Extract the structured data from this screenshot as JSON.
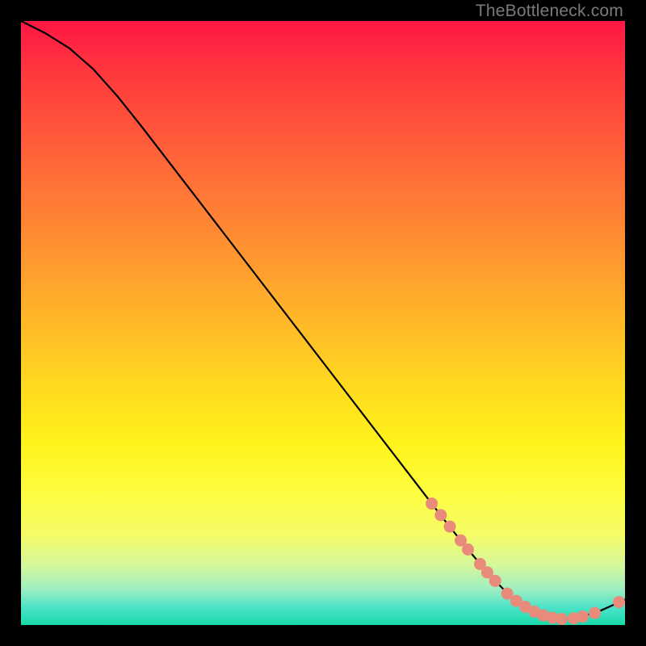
{
  "watermark": {
    "text": "TheBottleneck.com"
  },
  "colors": {
    "curve_stroke": "#000000",
    "marker_fill": "#e98b7a",
    "marker_stroke": "#d57463"
  },
  "chart_data": {
    "type": "line",
    "title": "",
    "xlabel": "",
    "ylabel": "",
    "xlim": [
      0,
      100
    ],
    "ylim": [
      0,
      100
    ],
    "grid": false,
    "curve": [
      {
        "x": 0,
        "y": 100
      },
      {
        "x": 4,
        "y": 98
      },
      {
        "x": 8,
        "y": 95.5
      },
      {
        "x": 12,
        "y": 92
      },
      {
        "x": 16,
        "y": 87.5
      },
      {
        "x": 20,
        "y": 82.5
      },
      {
        "x": 25,
        "y": 76
      },
      {
        "x": 30,
        "y": 69.5
      },
      {
        "x": 35,
        "y": 63
      },
      {
        "x": 40,
        "y": 56.5
      },
      {
        "x": 45,
        "y": 50
      },
      {
        "x": 50,
        "y": 43.5
      },
      {
        "x": 55,
        "y": 37
      },
      {
        "x": 60,
        "y": 30.5
      },
      {
        "x": 65,
        "y": 24
      },
      {
        "x": 70,
        "y": 17.5
      },
      {
        "x": 74,
        "y": 12.5
      },
      {
        "x": 78,
        "y": 7.8
      },
      {
        "x": 81,
        "y": 4.8
      },
      {
        "x": 84,
        "y": 2.6
      },
      {
        "x": 87,
        "y": 1.4
      },
      {
        "x": 90,
        "y": 1.0
      },
      {
        "x": 93,
        "y": 1.4
      },
      {
        "x": 96,
        "y": 2.4
      },
      {
        "x": 100,
        "y": 4.2
      }
    ],
    "markers": [
      {
        "x": 68.0,
        "y": 20.1
      },
      {
        "x": 69.5,
        "y": 18.2
      },
      {
        "x": 71.0,
        "y": 16.3
      },
      {
        "x": 72.8,
        "y": 14.0
      },
      {
        "x": 74.0,
        "y": 12.5
      },
      {
        "x": 76.0,
        "y": 10.1
      },
      {
        "x": 77.2,
        "y": 8.7
      },
      {
        "x": 78.5,
        "y": 7.3
      },
      {
        "x": 80.5,
        "y": 5.2
      },
      {
        "x": 82.0,
        "y": 4.0
      },
      {
        "x": 83.5,
        "y": 3.0
      },
      {
        "x": 85.0,
        "y": 2.2
      },
      {
        "x": 86.5,
        "y": 1.6
      },
      {
        "x": 88.0,
        "y": 1.2
      },
      {
        "x": 89.5,
        "y": 1.0
      },
      {
        "x": 91.5,
        "y": 1.1
      },
      {
        "x": 93.0,
        "y": 1.4
      },
      {
        "x": 95.0,
        "y": 2.0
      },
      {
        "x": 99.0,
        "y": 3.8
      }
    ]
  }
}
